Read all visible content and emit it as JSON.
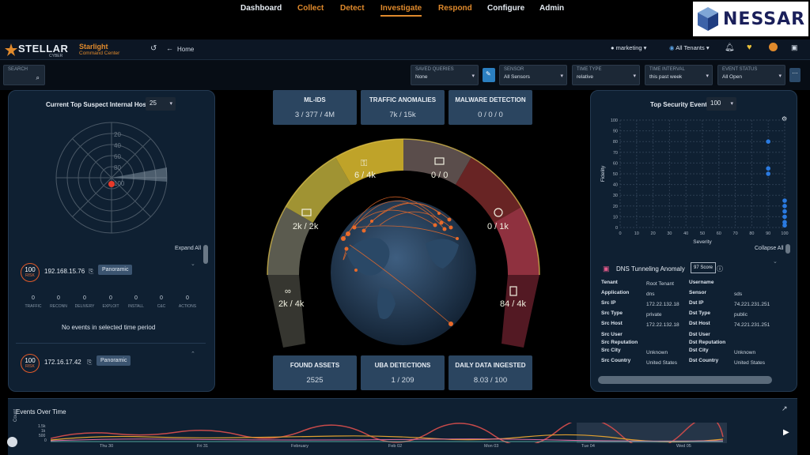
{
  "brand": {
    "stellar": "STELLAR",
    "cyber": "CYBER",
    "starlight": "Starlight",
    "command_center": "Command Center",
    "home": "Home",
    "nessar": "NESSAR"
  },
  "nav": [
    "Dashboard",
    "Collect",
    "Detect",
    "Investigate",
    "Respond",
    "Configure",
    "Admin"
  ],
  "user": {
    "name": "marketing ▾",
    "tenants": "All Tenants ▾"
  },
  "search_label": "SEARCH",
  "filters": {
    "saved_queries": {
      "label": "SAVED QUERIES",
      "value": "None"
    },
    "sensor": {
      "label": "SENSOR",
      "value": "All Sensors"
    },
    "time_type": {
      "label": "TIME TYPE",
      "value": "relative"
    },
    "time_interval": {
      "label": "TIME INTERVAL",
      "value": "this past week"
    },
    "event_status": {
      "label": "EVENT STATUS",
      "value": "All Open"
    }
  },
  "left_panel": {
    "title": "Current Top Suspect Internal Hosts",
    "count": "25",
    "radar_labels": [
      "20",
      "40",
      "60",
      "80",
      "100"
    ],
    "expand_all": "Expand All",
    "hosts": [
      {
        "risk": "100",
        "risk_label": "RISK",
        "ip": "192.168.15.76",
        "button": "Panoramic"
      },
      {
        "risk": "100",
        "risk_label": "RISK",
        "ip": "172.16.17.42",
        "button": "Panoramic"
      }
    ],
    "stats": [
      {
        "value": "0",
        "label": "TRAFFIC"
      },
      {
        "value": "0",
        "label": "RECONN"
      },
      {
        "value": "0",
        "label": "DELIVERY"
      },
      {
        "value": "0",
        "label": "EXPLOIT"
      },
      {
        "value": "0",
        "label": "INSTALL"
      },
      {
        "value": "0",
        "label": "C&C"
      },
      {
        "value": "0",
        "label": "ACTIONS"
      }
    ],
    "no_events": "No events in selected time period"
  },
  "center": {
    "top_metrics": [
      {
        "title": "ML-IDS",
        "value": "3 / 377 / 4M"
      },
      {
        "title": "TRAFFIC ANOMALIES",
        "value": "7k / 15k"
      },
      {
        "title": "MALWARE DETECTION",
        "value": "0 / 0 / 0"
      }
    ],
    "bottom_metrics": [
      {
        "title": "FOUND ASSETS",
        "value": "2525"
      },
      {
        "title": "UBA DETECTIONS",
        "value": "1 / 209"
      },
      {
        "title": "DAILY DATA INGESTED",
        "value": "8.03 / 100"
      }
    ],
    "arc_segments": [
      {
        "icon": "binoculars-icon",
        "value": "2k / 4k",
        "color": "#9a9a8a"
      },
      {
        "icon": "envelope-icon",
        "value": "2k / 2k",
        "color": "#d8c84a"
      },
      {
        "icon": "key-icon",
        "value": "6 / 4k",
        "color": "#e8c83a"
      },
      {
        "icon": "inbox-icon",
        "value": "0 / 0",
        "color": "#b0786a"
      },
      {
        "icon": "target-icon",
        "value": "0 / 1k",
        "color": "#c84a4a"
      },
      {
        "icon": "phone-icon",
        "value": "84 / 4k",
        "color": "#e05a6a"
      }
    ]
  },
  "right_panel": {
    "title": "Top Security Events",
    "count": "100",
    "collapse_all": "Collapse All",
    "event": {
      "name": "DNS Tunneling Anomaly",
      "score": "97 Score",
      "fields": [
        {
          "k1": "Tenant",
          "v1": "Root Tenant",
          "k2": "Username",
          "v2": ""
        },
        {
          "k1": "Application",
          "v1": "dns",
          "k2": "Sensor",
          "v2": "sds"
        },
        {
          "k1": "Src IP",
          "v1": "172.22.132.18",
          "k2": "Dst IP",
          "v2": "74.221.231.251"
        },
        {
          "k1": "Src Type",
          "v1": "private",
          "k2": "Dst Type",
          "v2": "public"
        },
        {
          "k1": "Src Host",
          "v1": "172.22.132.18",
          "k2": "Dst Host",
          "v2": "74.221.231.251"
        },
        {
          "k1": "Src User",
          "v1": "",
          "k2": "Dst User",
          "v2": ""
        },
        {
          "k1": "Src Reputation",
          "v1": "",
          "k2": "Dst Reputation",
          "v2": ""
        },
        {
          "k1": "Src City",
          "v1": "Unknown",
          "k2": "Dst City",
          "v2": "Unknown"
        },
        {
          "k1": "Src Country",
          "v1": "United States",
          "k2": "Dst Country",
          "v2": "United States"
        }
      ]
    }
  },
  "bottom": {
    "title": "Events Over Time",
    "y_axis_label": "Count",
    "y_ticks": [
      "1.5k",
      "1k",
      "500",
      "0"
    ],
    "x_ticks": [
      "Thu 30",
      "Fri 31",
      "February",
      "Feb 02",
      "Mon 03",
      "Tue 04",
      "Wed 05"
    ]
  },
  "chart_data": {
    "type": "scatter",
    "title": "Top Security Events",
    "xlabel": "Severity",
    "ylabel": "Fidelity",
    "xlim": [
      0,
      100
    ],
    "ylim": [
      0,
      100
    ],
    "x_ticks": [
      0,
      10,
      20,
      30,
      40,
      50,
      60,
      70,
      80,
      90,
      100
    ],
    "y_ticks": [
      0,
      10,
      20,
      30,
      40,
      50,
      60,
      70,
      80,
      90,
      100
    ],
    "grid": true,
    "points": [
      {
        "x": 90,
        "y": 80
      },
      {
        "x": 90,
        "y": 50
      },
      {
        "x": 90,
        "y": 55
      },
      {
        "x": 100,
        "y": 20
      },
      {
        "x": 100,
        "y": 15
      },
      {
        "x": 100,
        "y": 10
      },
      {
        "x": 100,
        "y": 5
      },
      {
        "x": 100,
        "y": 2
      },
      {
        "x": 100,
        "y": 25
      }
    ]
  }
}
